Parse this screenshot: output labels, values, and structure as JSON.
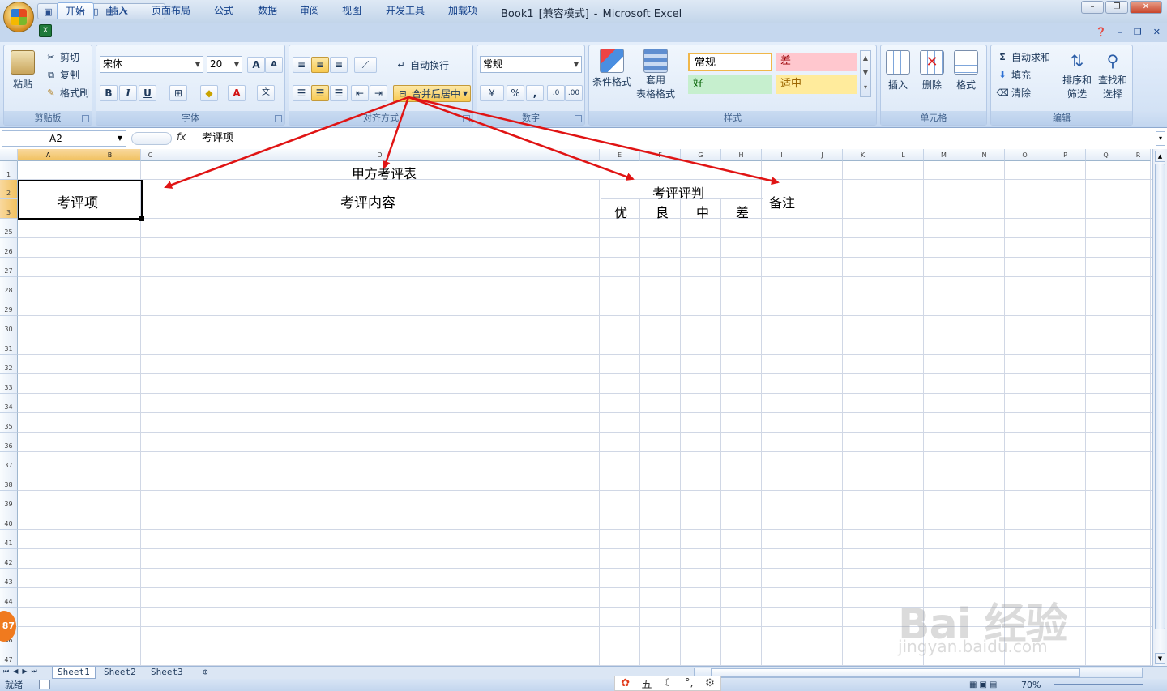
{
  "window": {
    "title_parts": [
      "Book1",
      "[兼容模式]",
      "-",
      "Microsoft Excel"
    ]
  },
  "tabs": [
    "开始",
    "插入",
    "页面布局",
    "公式",
    "数据",
    "审阅",
    "视图",
    "开发工具",
    "加载项"
  ],
  "clipboard": {
    "paste": "粘贴",
    "cut": "剪切",
    "copy": "复制",
    "format_painter": "格式刷",
    "label": "剪贴板"
  },
  "font": {
    "name": "宋体",
    "size": "20",
    "label": "字体",
    "bold": "B",
    "italic": "I",
    "underline": "U"
  },
  "alignment": {
    "wrap": "自动换行",
    "merge": "合并后居中",
    "label": "对齐方式"
  },
  "number": {
    "format": "常规",
    "percent": "%",
    "comma": ",",
    "label": "数字"
  },
  "styles": {
    "conditional": "条件格式",
    "table_fmt_1": "套用",
    "table_fmt_2": "表格格式",
    "normal": "常规",
    "bad": "差",
    "good": "好",
    "neutral": "适中",
    "label": "样式"
  },
  "cells_group": {
    "insert": "插入",
    "delete": "删除",
    "format": "格式",
    "label": "单元格"
  },
  "editing": {
    "autosum": "自动求和",
    "fill": "填充",
    "clear": "清除",
    "sort_1": "排序和",
    "sort_2": "筛选",
    "find_1": "查找和",
    "find_2": "选择",
    "label": "编辑"
  },
  "formula_bar": {
    "name_box": "A2",
    "fx": "fx",
    "content": "考评项"
  },
  "columns": [
    "A",
    "B",
    "C",
    "D",
    "E",
    "F",
    "G",
    "H",
    "I",
    "J",
    "K",
    "L",
    "M",
    "N",
    "O",
    "P",
    "Q",
    "R"
  ],
  "rows": [
    "1",
    "2",
    "3",
    "25",
    "26",
    "27",
    "28",
    "29",
    "30",
    "31",
    "32",
    "33",
    "34",
    "35",
    "36",
    "37",
    "38",
    "39",
    "40",
    "41",
    "42",
    "43",
    "44",
    "45",
    "46",
    "47"
  ],
  "sheet_cells": {
    "title": "甲方考评表",
    "item": "考评项",
    "content": "考评内容",
    "judge": "考评评判",
    "notes": "备注",
    "grades": [
      "优",
      "良",
      "中",
      "差"
    ]
  },
  "sheet_tabs": [
    "Sheet1",
    "Sheet2",
    "Sheet3"
  ],
  "status": {
    "ready": "就绪",
    "zoom": "70%"
  },
  "ime": [
    "五"
  ],
  "badge": "87",
  "watermark": {
    "line1": "Bai 经验",
    "line2": "jingyan.baidu.com"
  },
  "colors": {
    "annotation_arrow": "#e01414",
    "ribbon": "#dce8f7",
    "selected_header": "#f1c15f",
    "bad_style": "#ffc7ce",
    "good_style": "#c6efce",
    "neutral_style": "#ffeb9c"
  }
}
